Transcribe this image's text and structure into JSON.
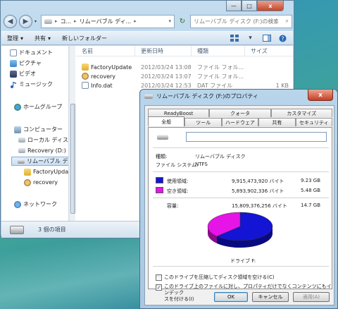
{
  "explorer": {
    "caption_min": "—",
    "caption_max": "□",
    "caption_close": "x",
    "back_icon": "◀",
    "forward_icon": "▶",
    "address": {
      "seg1": "コ...",
      "seg2": "リムーバブル ディ...",
      "sep": "▸",
      "tail": "▾"
    },
    "refresh_icon": "↻",
    "search_placeholder": "リムーバブル ディスク (F:)の検索",
    "search_icon": "⌕",
    "toolbar": {
      "organize": "整理",
      "share": "共有",
      "new_folder": "新しいフォルダー",
      "dropdown": "▾"
    },
    "tree": [
      {
        "label": "ドキュメント",
        "icon": "document-icon"
      },
      {
        "label": "ピクチャ",
        "icon": "picture-icon"
      },
      {
        "label": "ビデオ",
        "icon": "video-icon"
      },
      {
        "label": "ミュージック",
        "icon": "music-icon"
      },
      {
        "label": "ホームグループ",
        "icon": "homegroup-icon"
      },
      {
        "label": "コンピューター",
        "icon": "computer-icon"
      },
      {
        "label": "ローカル ディス",
        "icon": "local-disk-icon"
      },
      {
        "label": "Recovery (D:)",
        "icon": "recovery-drive-icon"
      },
      {
        "label": "リムーバブル デ",
        "icon": "removable-disk-icon"
      },
      {
        "label": "FactoryUpdat",
        "icon": "folder-icon"
      },
      {
        "label": "recovery",
        "icon": "recovery-icon"
      },
      {
        "label": "ネットワーク",
        "icon": "network-icon"
      }
    ],
    "columns": {
      "name": "名前",
      "date": "更新日時",
      "type": "種類",
      "size": "サイズ"
    },
    "files": [
      {
        "name": "FactoryUpdate",
        "date": "2012/03/24 13:08",
        "type": "ファイル フォル...",
        "size": ""
      },
      {
        "name": "recovery",
        "date": "2012/03/24 13:07",
        "type": "ファイル フォル...",
        "size": ""
      },
      {
        "name": "Info.dat",
        "date": "2012/03/24 12:53",
        "type": "DAT ファイル",
        "size": "1 KB"
      }
    ],
    "status": "3 個の項目"
  },
  "dialog": {
    "title": "リムーバブル ディスク (F:)のプロパティ",
    "close": "x",
    "tabs_row1": [
      "ReadyBoost",
      "クォータ",
      "カスタマイズ"
    ],
    "tabs_row2": [
      "全般",
      "ツール",
      "ハードウェア",
      "共有",
      "セキュリティ"
    ],
    "name_value": "",
    "type_label": "種類:",
    "type_value": "リムーバブル ディスク",
    "fs_label": "ファイル システム:",
    "fs_value": "NTFS",
    "used_label": "使用領域:",
    "used_bytes": "9,915,473,920 バイト",
    "used_gb": "9.23 GB",
    "free_label": "空き領域:",
    "free_bytes": "5,893,902,336 バイト",
    "free_gb": "5.48 GB",
    "capacity_label": "容量:",
    "capacity_bytes": "15,809,376,256 バイト",
    "capacity_gb": "14.7 GB",
    "drive_label": "ドライブ F:",
    "compress_label": "このドライブを圧縮してディスク領域を空ける(C)",
    "index_label_1": "このドライブ上のファイルに対し、プロパティだけでなくコンテンツにもインデック",
    "index_label_2": "スを付ける(I)",
    "check_mark": "✓",
    "ok": "OK",
    "cancel": "キャンセル",
    "apply": "適用(A)"
  },
  "chart_data": {
    "type": "pie",
    "categories": [
      "使用領域",
      "空き領域"
    ],
    "values": [
      9.23,
      5.48
    ],
    "colors": [
      "#1414d4",
      "#e614e6"
    ],
    "title": "",
    "xlabel": "",
    "ylabel": ""
  }
}
